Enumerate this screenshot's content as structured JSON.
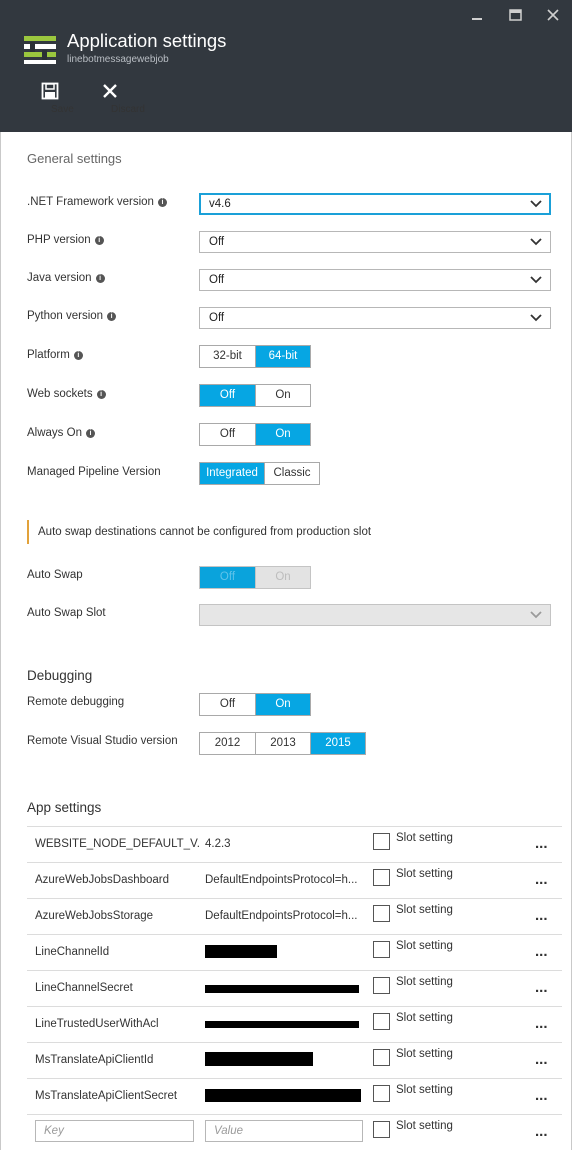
{
  "header": {
    "title": "Application settings",
    "subtitle": "linebotmessagewebjob",
    "commands": [
      {
        "label": "Save",
        "icon": "save-icon"
      },
      {
        "label": "Discard",
        "icon": "close-icon"
      }
    ],
    "window_controls": [
      "minimize-icon",
      "maximize-icon",
      "close-icon"
    ]
  },
  "general": {
    "heading": "General settings",
    "net_framework": {
      "label": ".NET Framework version",
      "value": "v4.6"
    },
    "php": {
      "label": "PHP version",
      "value": "Off"
    },
    "java": {
      "label": "Java version",
      "value": "Off"
    },
    "python": {
      "label": "Python version",
      "value": "Off"
    },
    "platform": {
      "label": "Platform",
      "options": [
        "32-bit",
        "64-bit"
      ],
      "selected": "64-bit"
    },
    "web_sockets": {
      "label": "Web sockets",
      "options": [
        "Off",
        "On"
      ],
      "selected": "Off"
    },
    "always_on": {
      "label": "Always On",
      "options": [
        "Off",
        "On"
      ],
      "selected": "On"
    },
    "pipeline": {
      "label": "Managed Pipeline Version",
      "options": [
        "Integrated",
        "Classic"
      ],
      "selected": "Integrated"
    }
  },
  "auto_swap": {
    "notice": "Auto swap destinations cannot be configured from production slot",
    "label": "Auto Swap",
    "options": [
      "Off",
      "On"
    ],
    "selected": "Off",
    "slot_label": "Auto Swap Slot",
    "slot_value": ""
  },
  "debugging": {
    "heading": "Debugging",
    "remote": {
      "label": "Remote debugging",
      "options": [
        "Off",
        "On"
      ],
      "selected": "On"
    },
    "vs_version": {
      "label": "Remote Visual Studio version",
      "options": [
        "2012",
        "2013",
        "2015"
      ],
      "selected": "2015"
    }
  },
  "app_settings": {
    "heading": "App settings",
    "slot_label": "Slot setting",
    "more": "...",
    "rows": [
      {
        "key": "WEBSITE_NODE_DEFAULT_V...",
        "value": "4.2.3"
      },
      {
        "key": "AzureWebJobsDashboard",
        "value": "DefaultEndpointsProtocol=h..."
      },
      {
        "key": "AzureWebJobsStorage",
        "value": "DefaultEndpointsProtocol=h..."
      },
      {
        "key": "LineChannelId",
        "value": ""
      },
      {
        "key": "LineChannelSecret",
        "value": ""
      },
      {
        "key": "LineTrustedUserWithAcl",
        "value": ""
      },
      {
        "key": "MsTranslateApiClientId",
        "value": ""
      },
      {
        "key": "MsTranslateApiClientSecret",
        "value": ""
      }
    ],
    "new_key_placeholder": "Key",
    "new_value_placeholder": "Value"
  },
  "colors": {
    "header_bg": "#32383f",
    "accent": "#06a6e3",
    "notice": "#e2a23a"
  }
}
